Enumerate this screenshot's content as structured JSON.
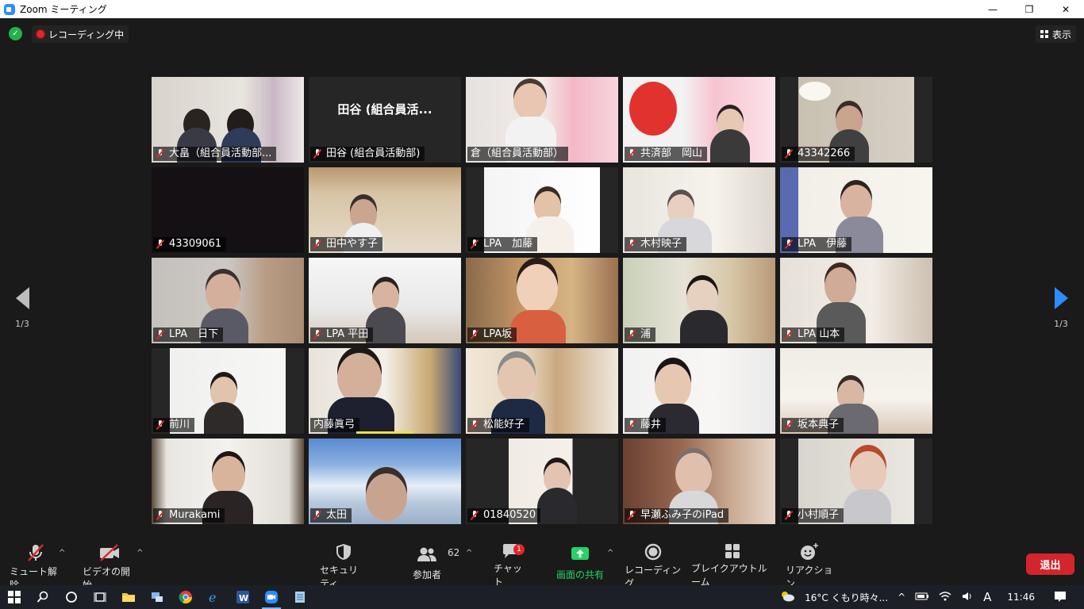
{
  "window": {
    "title": "Zoom ミーティング",
    "minimize_glyph": "—",
    "maximize_glyph": "❐",
    "close_glyph": "✕"
  },
  "topbar": {
    "recording_label": "レコーディング中",
    "view_label": "表示"
  },
  "page_indicator": {
    "left": "1/3",
    "right": "1/3"
  },
  "participants": [
    {
      "name": "大畠（組合員活動部..."
    },
    {
      "name": "田谷 (組合員活動部)",
      "display": "田谷 (組合員活..."
    },
    {
      "name": "倉（組合員活動部）"
    },
    {
      "name": "共済部　岡山"
    },
    {
      "name": "43342266"
    },
    {
      "name": "43309061"
    },
    {
      "name": "田中やす子"
    },
    {
      "name": "LPA　加藤"
    },
    {
      "name": "木村映子"
    },
    {
      "name": "LPA　伊藤"
    },
    {
      "name": "LPA　日下"
    },
    {
      "name": "LPA 平田"
    },
    {
      "name": "LPA坂"
    },
    {
      "name": "浦"
    },
    {
      "name": "LPA 山本"
    },
    {
      "name": "前川"
    },
    {
      "name": "内藤眞弓"
    },
    {
      "name": "松能好子"
    },
    {
      "name": "藤井"
    },
    {
      "name": "坂本典子"
    },
    {
      "name": "Murakami"
    },
    {
      "name": "太田"
    },
    {
      "name": "01840520"
    },
    {
      "name": "早瀬ふみ子のiPad"
    },
    {
      "name": "小村順子"
    }
  ],
  "toolbar": {
    "mute": "ミュート解除",
    "video": "ビデオの開始",
    "security": "セキュリティ",
    "participants": "参加者",
    "participants_count": "62",
    "chat": "チャット",
    "chat_badge": "1",
    "share": "画面の共有",
    "record": "レコーディング",
    "breakout": "ブレイクアウトルーム",
    "reactions": "リアクション",
    "leave": "退出"
  },
  "taskbar": {
    "weather": "16°C  くもり時々...",
    "ime": "A",
    "time": "11:46"
  },
  "colors": {
    "accent": "#2d8cff",
    "leave": "#d3252b",
    "share_green": "#25d366",
    "active_border": "#d8e43a"
  }
}
